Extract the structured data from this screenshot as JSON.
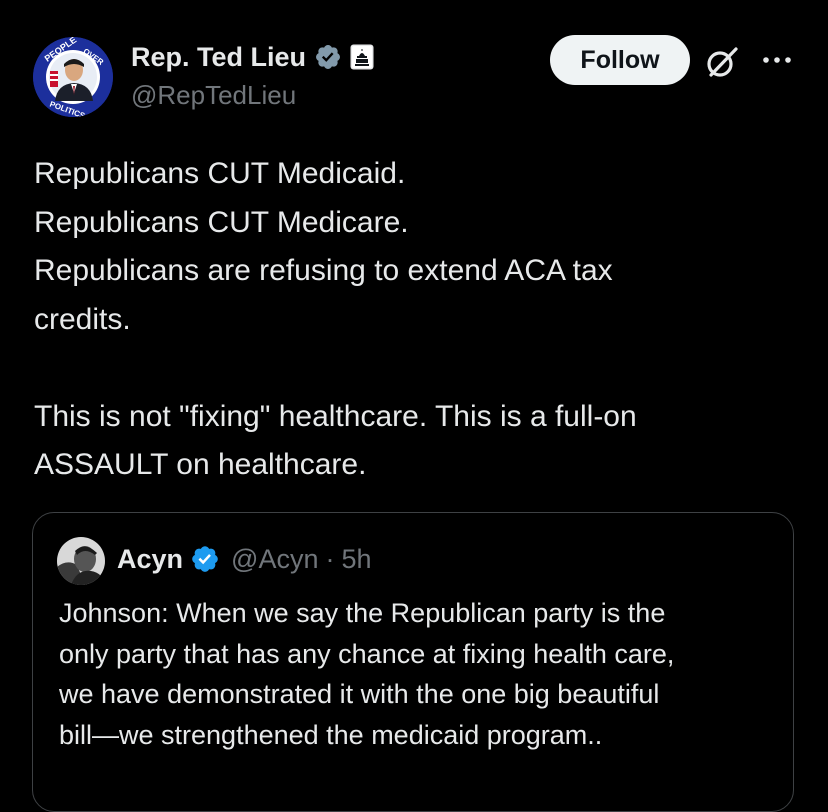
{
  "author": {
    "display_name": "Rep. Ted Lieu",
    "handle": "@RepTedLieu",
    "avatar_ring_text": "PEOPLE OVER POLITICS",
    "verified_icon": "verified-badge-icon",
    "affiliation_icon": "us-capitol-icon"
  },
  "actions": {
    "follow_label": "Follow",
    "grok_icon": "grok-icon",
    "more_icon": "more-options-icon"
  },
  "tweet": {
    "lines": [
      "Republicans CUT Medicaid.",
      "Republicans CUT Medicare.",
      "Republicans are refusing to extend ACA tax",
      "credits.",
      "",
      "This is not \"fixing\" healthcare. This is a full-on",
      "ASSAULT on healthcare."
    ]
  },
  "quoted": {
    "display_name": "Acyn",
    "handle": "@Acyn",
    "separator": "·",
    "time": "5h",
    "lines": [
      "Johnson: When we say the Republican party is the",
      "only party that has any chance at fixing health care,",
      "we have demonstrated it with the one big beautiful",
      "bill—we strengthened the medicaid program.."
    ]
  },
  "colors": {
    "background": "#000000",
    "text_primary": "#e7e9ea",
    "text_secondary": "#71767b",
    "verified_blue": "#1d9bf0",
    "verified_gray": "#829aab",
    "follow_bg": "#eff3f4",
    "border": "#3e4144"
  }
}
